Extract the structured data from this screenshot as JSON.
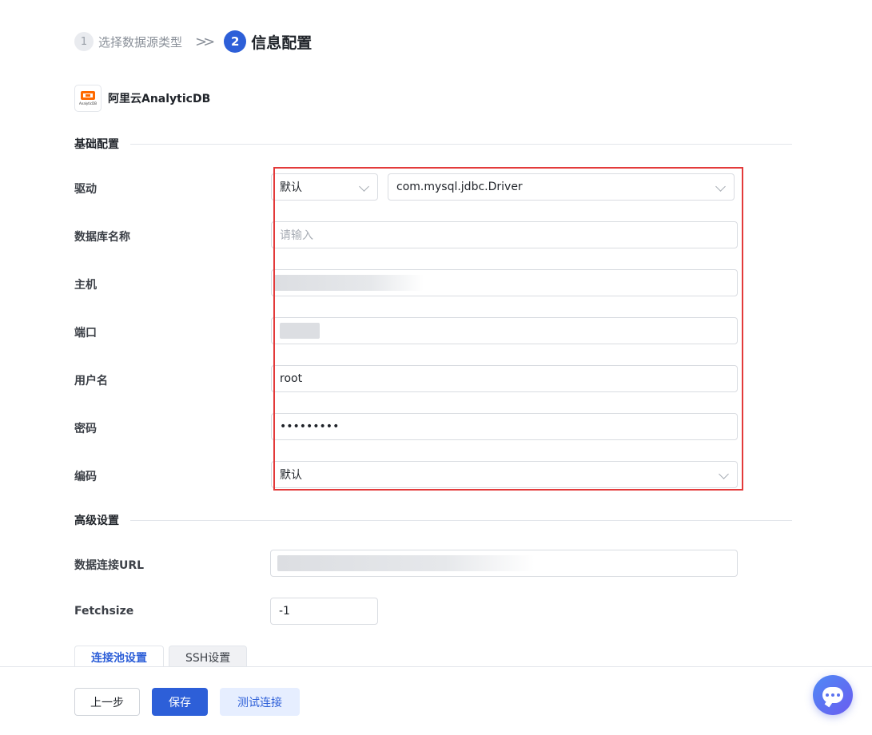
{
  "steps": [
    {
      "number": "1",
      "label": "选择数据源类型"
    },
    {
      "number": "2",
      "label": "信息配置"
    }
  ],
  "step_separator": "»",
  "datasource": {
    "name": "阿里云AnalyticDB",
    "logo_text": "AnalyticDB"
  },
  "basic": {
    "title": "基础配置",
    "driver": {
      "label": "驱动",
      "mode_value": "默认",
      "class_value": "com.mysql.jdbc.Driver"
    },
    "database": {
      "label": "数据库名称",
      "placeholder": "请输入"
    },
    "host": {
      "label": "主机"
    },
    "port": {
      "label": "端口"
    },
    "username": {
      "label": "用户名",
      "value": "root"
    },
    "password": {
      "label": "密码",
      "value": "•••••••••"
    },
    "encoding": {
      "label": "编码",
      "value": "默认"
    }
  },
  "advanced": {
    "title": "高级设置",
    "url": {
      "label": "数据连接URL"
    },
    "fetchsize": {
      "label": "Fetchsize",
      "value": "-1"
    }
  },
  "tabs": [
    {
      "label": "连接池设置",
      "active": true
    },
    {
      "label": "SSH设置",
      "active": false
    }
  ],
  "footer": {
    "prev_label": "上一步",
    "save_label": "保存",
    "test_label": "测试连接"
  },
  "colors": {
    "primary": "#2d5fd8",
    "highlight_border": "#e33a3a",
    "logo_orange": "#ff6a00"
  }
}
